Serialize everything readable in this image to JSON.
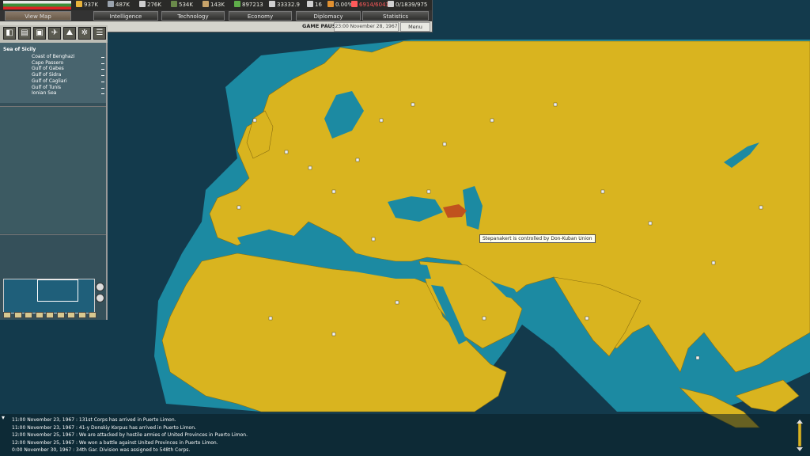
{
  "resources": [
    {
      "icon": "energy-icon",
      "value": "937K",
      "color": "#e8b33a"
    },
    {
      "icon": "metal-icon",
      "value": "487K",
      "color": "#9aa3ad"
    },
    {
      "icon": "rare-materials-icon",
      "value": "276K",
      "color": "#cfcfcf"
    },
    {
      "icon": "oil-icon",
      "value": "534K",
      "color": "#6a8a4a"
    },
    {
      "icon": "supplies-icon",
      "value": "143K",
      "color": "#c7a36a"
    },
    {
      "icon": "money-icon",
      "value": "897213",
      "color": "#5fae4a"
    },
    {
      "icon": "manpower-icon",
      "value": "33332.9",
      "color": "#d0d0d0"
    },
    {
      "icon": "transports-icon",
      "value": "16",
      "color": "#d0d0d0"
    },
    {
      "icon": "dissent-icon",
      "value": "0.00%",
      "color": "#e09030"
    },
    {
      "icon": "ic-icon",
      "value": "6914/6041",
      "color": "#ff5a5a"
    },
    {
      "icon": "convoys-icon",
      "value": "0/1839/975",
      "color": "#d0d0d0"
    }
  ],
  "tabs": [
    "View Map",
    "Intelligence",
    "Technology",
    "Economy",
    "Diplomacy",
    "Statistics"
  ],
  "status": {
    "paused": "GAME PAUSED",
    "date": "23:00 November 28, 1967",
    "menu": "Menu"
  },
  "toolbar": [
    "province-icon",
    "ledger-icon",
    "production-icon",
    "air-icon",
    "army-icon",
    "division-icon",
    "options-icon"
  ],
  "province_panel": {
    "title": "Sea of Sicily",
    "items": [
      "Coast of Benghazi",
      "Capo Passero",
      "Gulf of Gabes",
      "Gulf of Sidra",
      "Gulf of Cagliari",
      "Gulf of Tunis",
      "Ionian Sea"
    ]
  },
  "tooltip": "Stepanakert is controlled by Don-Kuban Union",
  "log": [
    "11:00 November 23, 1967 : 131st Corps has arrived in Puerto Limon.",
    "11:00 November 23, 1967 : 41-y Donskiy Korpus has arrived in Puerto Limon.",
    "12:00 November 25, 1967 : We are attacked by hostile armies of United Provinces in Puerto Limon.",
    "12:00 November 25, 1967 : We won a battle against United Provinces in Puerto Limon.",
    "0:00 November 30, 1967 : 34th Gar. Division was assigned to 548th Corps."
  ],
  "colors": {
    "land": "#d9b41f",
    "sea": "#1f8aa3",
    "ocean": "#14384a",
    "highlight": "#c0521e"
  }
}
